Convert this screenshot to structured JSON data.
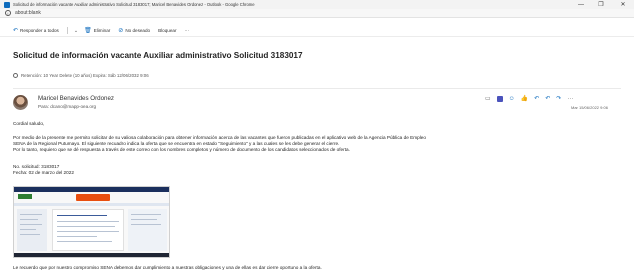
{
  "window": {
    "title": "Solicitud de información vacante Auxiliar administrativo Solicitud 3183017; Maricel Benavides Ordonez - Outlook - Google Chrome",
    "min_glyph": "—",
    "max_glyph": "❐",
    "close_glyph": "✕"
  },
  "browser": {
    "url": "about:blank",
    "info_glyph": "i"
  },
  "toolbar": {
    "reply_all_icon": "↶",
    "reply_all_label": "Responder a todos",
    "dropdown_glyph": "⌄",
    "delete_icon": "🗑",
    "delete_label": "Eliminar",
    "junk_icon": "⊘",
    "junk_label": "No deseado",
    "block_label": "Bloquear",
    "more_glyph": "···"
  },
  "email": {
    "subject": "Solicitud de información vacante Auxiliar administrativo Solicitud 3183017",
    "retention": "Retención: 10 Year Delete (10 años) Expira: Sáb 12/06/2032 9:06",
    "sender": "Maricel Benavides Ordonez",
    "to": "Para:  dcano@mapp-oea.org",
    "date": "Mar 15/06/2022 9:06",
    "actions": {
      "open_glyph": "▭",
      "emoji_glyph": "☺",
      "like_glyph": "👍",
      "reply_glyph": "↶",
      "reply_all_glyph": "↶",
      "forward_glyph": "↷",
      "more_glyph": "···"
    },
    "body": {
      "greeting": "Cordial saludo,",
      "p1_line1": "Por medio de la presente me permito solicitar de su valiosa colaboración para obtener información acerca de las vacantes que fueron publicadas en el aplicativo web de la Agencia Pública de Empleo",
      "p1_line2": "SENA de la Regional Putumayo. El siguiente recuadro indica la oferta que se encuentra en estado \"Seguimiento\" y a las cuales se les debe generar el cierre.",
      "p1_line3": "Por lo tanto, requiero que se dé respuesta a través de este correo con los nombres completos y número de documento de los candidatos seleccionados de oferta.",
      "request_no": "No. solicitud: 3183017",
      "request_date": "Fecha: 02 de marzo del 2022",
      "closing": "Le recuerdo que por nuestro compromiso SENA debemos dar cumplimiento a nuestras obligaciones y una de ellas es dar cierre oportuno a la oferta."
    }
  },
  "colors": {
    "accent": "#0f6cbd",
    "text": "#242424",
    "muted": "#666666"
  }
}
